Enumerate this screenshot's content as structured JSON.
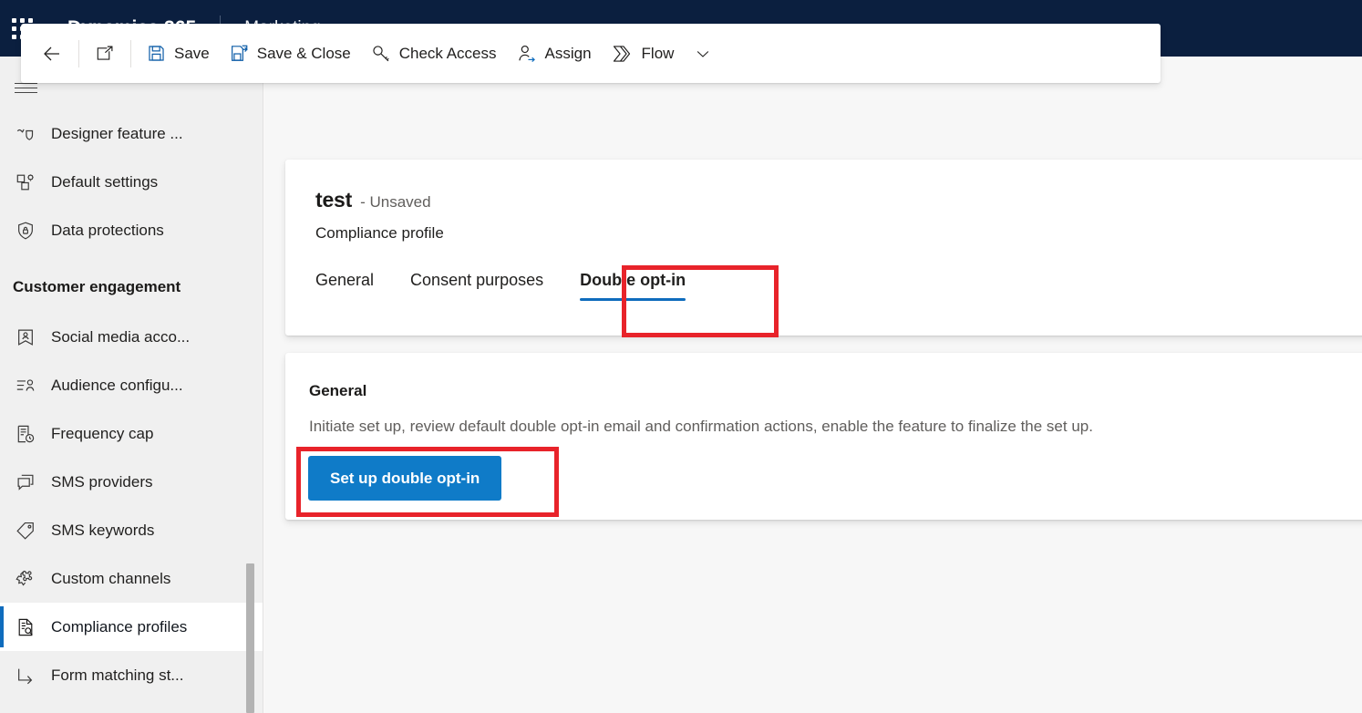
{
  "appbar": {
    "waffle_icon": "waffle-grid-icon",
    "brand": "Dynamics 365",
    "app_name": "Marketing"
  },
  "sidebar": {
    "hamburger_icon": "hamburger-menu-icon",
    "items_top": [
      {
        "label": "Designer feature ...",
        "icon": "designer-feature-icon",
        "selected": false
      },
      {
        "label": "Default settings",
        "icon": "default-settings-icon",
        "selected": false
      },
      {
        "label": "Data protections",
        "icon": "shield-lock-icon",
        "selected": false
      }
    ],
    "group_label": "Customer engagement",
    "items_group": [
      {
        "label": "Social media acco...",
        "icon": "social-media-account-icon",
        "selected": false
      },
      {
        "label": "Audience configu...",
        "icon": "audience-configuration-icon",
        "selected": false
      },
      {
        "label": "Frequency cap",
        "icon": "frequency-cap-icon",
        "selected": false
      },
      {
        "label": "SMS providers",
        "icon": "sms-providers-icon",
        "selected": false
      },
      {
        "label": "SMS keywords",
        "icon": "sms-keywords-tag-icon",
        "selected": false
      },
      {
        "label": "Custom channels",
        "icon": "custom-channels-puzzle-icon",
        "selected": false
      },
      {
        "label": "Compliance profiles",
        "icon": "compliance-profiles-icon",
        "selected": true
      },
      {
        "label": "Form matching st...",
        "icon": "form-matching-strategy-icon",
        "selected": false
      }
    ]
  },
  "commandbar": {
    "back_icon": "back-arrow-icon",
    "popout_icon": "open-in-new-window-icon",
    "save_label": "Save",
    "save_icon": "save-floppy-icon",
    "save_close_label": "Save & Close",
    "save_close_icon": "save-and-close-icon",
    "check_access_label": "Check Access",
    "check_access_icon": "key-icon",
    "assign_label": "Assign",
    "assign_icon": "assign-person-icon",
    "flow_label": "Flow",
    "flow_icon": "power-automate-flow-icon",
    "overflow_icon": "chevron-down-icon"
  },
  "record": {
    "name": "test",
    "state": "- Unsaved",
    "entity": "Compliance profile",
    "tabs": [
      {
        "label": "General",
        "active": false
      },
      {
        "label": "Consent purposes",
        "active": false
      },
      {
        "label": "Double opt-in",
        "active": true
      }
    ]
  },
  "content": {
    "section_title": "General",
    "description": "Initiate set up, review default double opt-in email and confirmation actions, enable the feature to finalize the set up.",
    "primary_button": "Set up double opt-in"
  },
  "colors": {
    "appbar_bg": "#0b1f3f",
    "accent_blue": "#0f6cbd",
    "primary_button_bg": "#0f7bc8",
    "annotation_red": "#e8232a",
    "sidebar_bg": "#f0f0f0",
    "canvas_bg": "#f7f7f7"
  },
  "annotations": [
    {
      "name": "double-opt-in-tab-highlight",
      "target": "Double opt-in"
    },
    {
      "name": "set-up-double-opt-in-button-highlight",
      "target": "Set up double opt-in"
    }
  ]
}
